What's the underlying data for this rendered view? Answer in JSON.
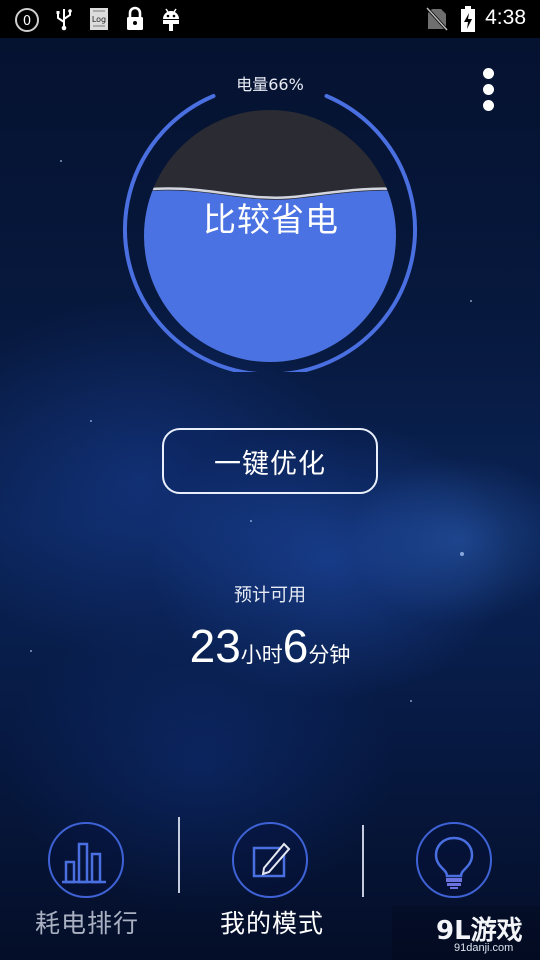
{
  "status_bar": {
    "time": "4:38",
    "icons": [
      "notification-count-icon",
      "usb-icon",
      "log-icon",
      "lock-icon",
      "android-debug-icon",
      "no-sim-icon",
      "battery-charging-icon"
    ],
    "notification_count": "0",
    "log_icon_text": "Log"
  },
  "battery": {
    "label": "电量66%",
    "level": 0.66,
    "mode_text": "比较省电"
  },
  "actions": {
    "optimize_label": "一键优化"
  },
  "estimate": {
    "label": "预计可用",
    "hours": "23",
    "hours_unit": "小时",
    "minutes": "6",
    "minutes_unit": "分钟"
  },
  "bottom_nav": {
    "items": [
      {
        "label": "耗电排行",
        "icon": "bar-chart-icon",
        "active": false
      },
      {
        "label": "我的模式",
        "icon": "edit-note-icon",
        "active": true
      },
      {
        "label": "",
        "icon": "light-bulb-icon",
        "active": false
      }
    ]
  },
  "watermark": {
    "logo": "9L游戏",
    "url": "91danji.com"
  },
  "colors": {
    "accent": "#4a6fe0",
    "ring": "#3f63d6",
    "liquid": "#4a72e2",
    "liquid_empty": "#2a2b33",
    "inactive_label": "#a9b0c2",
    "active_label": "#ffffff"
  }
}
